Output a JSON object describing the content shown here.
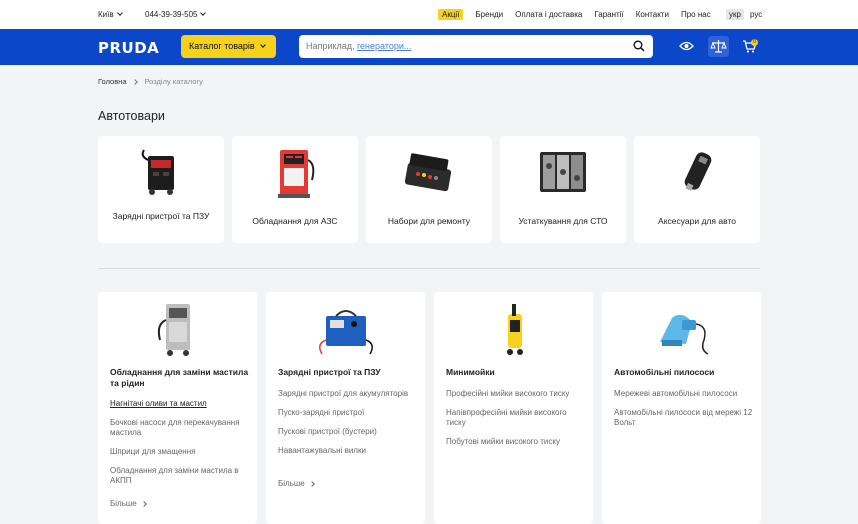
{
  "topbar": {
    "city": "Київ",
    "phone": "044-39-39-505",
    "nav": [
      "Акції",
      "Бренди",
      "Оплата і доставка",
      "Гарантії",
      "Контакти",
      "Про нас"
    ],
    "langs": [
      "укр",
      "рус"
    ]
  },
  "header": {
    "logo": "PRUDA",
    "catalog_label": "Каталог товарів",
    "search_placeholder_prefix": "Наприклад, ",
    "search_placeholder_link": "генератори...",
    "cart_count": "0"
  },
  "breadcrumb": {
    "home": "Головна",
    "current": "Розділу каталогу"
  },
  "page_title": "Автотовари",
  "categories": [
    {
      "label": "Зарядні пристрої та ПЗУ",
      "icon": "charger-image"
    },
    {
      "label": "Обладнання для АЗС",
      "icon": "fuel-dispenser-image"
    },
    {
      "label": "Набори для ремонту",
      "icon": "repair-kit-image"
    },
    {
      "label": "Устаткування для СТО",
      "icon": "tool-set-image"
    },
    {
      "label": "Аксесуари для авто",
      "icon": "car-charger-image"
    }
  ],
  "sections": [
    {
      "title": "Обладнання для заміни мастила та рідин",
      "items": [
        "Нагнітачі оливи та мастил",
        "Бочкові насоси для перекачування мастила",
        "Шприци для змащення",
        "Обладнання для заміни мастила в АКПП"
      ],
      "more": "Більше"
    },
    {
      "title": "Зарядні пристрої та ПЗУ",
      "items": [
        "Зарядні пристрої для акумуляторів",
        "Пуско-зарядні пристрої",
        "Пускові пристрої (бустери)",
        "Навантажувальні вилки"
      ],
      "more": "Більше"
    },
    {
      "title": "Минимойки",
      "items": [
        "Професійні мийки високого тиску",
        "Напівпрофесійні мийки високого тиску",
        "Побутові мийки високого тиску"
      ]
    },
    {
      "title": "Автомобільні пилососи",
      "items": [
        "Мережеві автомобільні пилососи",
        "Автомобільні пилососи від мережі 12 Вольт"
      ]
    }
  ],
  "colors": {
    "brand_blue": "#0d47c9",
    "accent_yellow": "#f6d21c"
  }
}
